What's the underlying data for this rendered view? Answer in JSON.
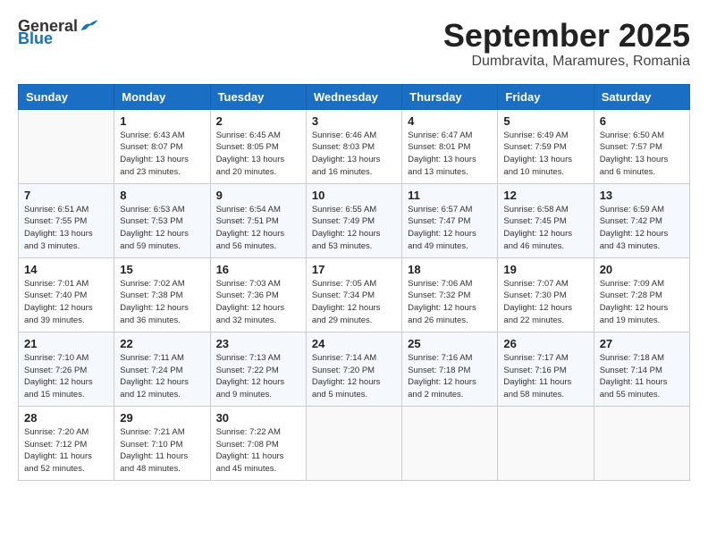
{
  "header": {
    "logo_general": "General",
    "logo_blue": "Blue",
    "month": "September 2025",
    "location": "Dumbravita, Maramures, Romania"
  },
  "weekdays": [
    "Sunday",
    "Monday",
    "Tuesday",
    "Wednesday",
    "Thursday",
    "Friday",
    "Saturday"
  ],
  "weeks": [
    [
      {
        "day": "",
        "info": ""
      },
      {
        "day": "1",
        "info": "Sunrise: 6:43 AM\nSunset: 8:07 PM\nDaylight: 13 hours\nand 23 minutes."
      },
      {
        "day": "2",
        "info": "Sunrise: 6:45 AM\nSunset: 8:05 PM\nDaylight: 13 hours\nand 20 minutes."
      },
      {
        "day": "3",
        "info": "Sunrise: 6:46 AM\nSunset: 8:03 PM\nDaylight: 13 hours\nand 16 minutes."
      },
      {
        "day": "4",
        "info": "Sunrise: 6:47 AM\nSunset: 8:01 PM\nDaylight: 13 hours\nand 13 minutes."
      },
      {
        "day": "5",
        "info": "Sunrise: 6:49 AM\nSunset: 7:59 PM\nDaylight: 13 hours\nand 10 minutes."
      },
      {
        "day": "6",
        "info": "Sunrise: 6:50 AM\nSunset: 7:57 PM\nDaylight: 13 hours\nand 6 minutes."
      }
    ],
    [
      {
        "day": "7",
        "info": "Sunrise: 6:51 AM\nSunset: 7:55 PM\nDaylight: 13 hours\nand 3 minutes."
      },
      {
        "day": "8",
        "info": "Sunrise: 6:53 AM\nSunset: 7:53 PM\nDaylight: 12 hours\nand 59 minutes."
      },
      {
        "day": "9",
        "info": "Sunrise: 6:54 AM\nSunset: 7:51 PM\nDaylight: 12 hours\nand 56 minutes."
      },
      {
        "day": "10",
        "info": "Sunrise: 6:55 AM\nSunset: 7:49 PM\nDaylight: 12 hours\nand 53 minutes."
      },
      {
        "day": "11",
        "info": "Sunrise: 6:57 AM\nSunset: 7:47 PM\nDaylight: 12 hours\nand 49 minutes."
      },
      {
        "day": "12",
        "info": "Sunrise: 6:58 AM\nSunset: 7:45 PM\nDaylight: 12 hours\nand 46 minutes."
      },
      {
        "day": "13",
        "info": "Sunrise: 6:59 AM\nSunset: 7:42 PM\nDaylight: 12 hours\nand 43 minutes."
      }
    ],
    [
      {
        "day": "14",
        "info": "Sunrise: 7:01 AM\nSunset: 7:40 PM\nDaylight: 12 hours\nand 39 minutes."
      },
      {
        "day": "15",
        "info": "Sunrise: 7:02 AM\nSunset: 7:38 PM\nDaylight: 12 hours\nand 36 minutes."
      },
      {
        "day": "16",
        "info": "Sunrise: 7:03 AM\nSunset: 7:36 PM\nDaylight: 12 hours\nand 32 minutes."
      },
      {
        "day": "17",
        "info": "Sunrise: 7:05 AM\nSunset: 7:34 PM\nDaylight: 12 hours\nand 29 minutes."
      },
      {
        "day": "18",
        "info": "Sunrise: 7:06 AM\nSunset: 7:32 PM\nDaylight: 12 hours\nand 26 minutes."
      },
      {
        "day": "19",
        "info": "Sunrise: 7:07 AM\nSunset: 7:30 PM\nDaylight: 12 hours\nand 22 minutes."
      },
      {
        "day": "20",
        "info": "Sunrise: 7:09 AM\nSunset: 7:28 PM\nDaylight: 12 hours\nand 19 minutes."
      }
    ],
    [
      {
        "day": "21",
        "info": "Sunrise: 7:10 AM\nSunset: 7:26 PM\nDaylight: 12 hours\nand 15 minutes."
      },
      {
        "day": "22",
        "info": "Sunrise: 7:11 AM\nSunset: 7:24 PM\nDaylight: 12 hours\nand 12 minutes."
      },
      {
        "day": "23",
        "info": "Sunrise: 7:13 AM\nSunset: 7:22 PM\nDaylight: 12 hours\nand 9 minutes."
      },
      {
        "day": "24",
        "info": "Sunrise: 7:14 AM\nSunset: 7:20 PM\nDaylight: 12 hours\nand 5 minutes."
      },
      {
        "day": "25",
        "info": "Sunrise: 7:16 AM\nSunset: 7:18 PM\nDaylight: 12 hours\nand 2 minutes."
      },
      {
        "day": "26",
        "info": "Sunrise: 7:17 AM\nSunset: 7:16 PM\nDaylight: 11 hours\nand 58 minutes."
      },
      {
        "day": "27",
        "info": "Sunrise: 7:18 AM\nSunset: 7:14 PM\nDaylight: 11 hours\nand 55 minutes."
      }
    ],
    [
      {
        "day": "28",
        "info": "Sunrise: 7:20 AM\nSunset: 7:12 PM\nDaylight: 11 hours\nand 52 minutes."
      },
      {
        "day": "29",
        "info": "Sunrise: 7:21 AM\nSunset: 7:10 PM\nDaylight: 11 hours\nand 48 minutes."
      },
      {
        "day": "30",
        "info": "Sunrise: 7:22 AM\nSunset: 7:08 PM\nDaylight: 11 hours\nand 45 minutes."
      },
      {
        "day": "",
        "info": ""
      },
      {
        "day": "",
        "info": ""
      },
      {
        "day": "",
        "info": ""
      },
      {
        "day": "",
        "info": ""
      }
    ]
  ]
}
